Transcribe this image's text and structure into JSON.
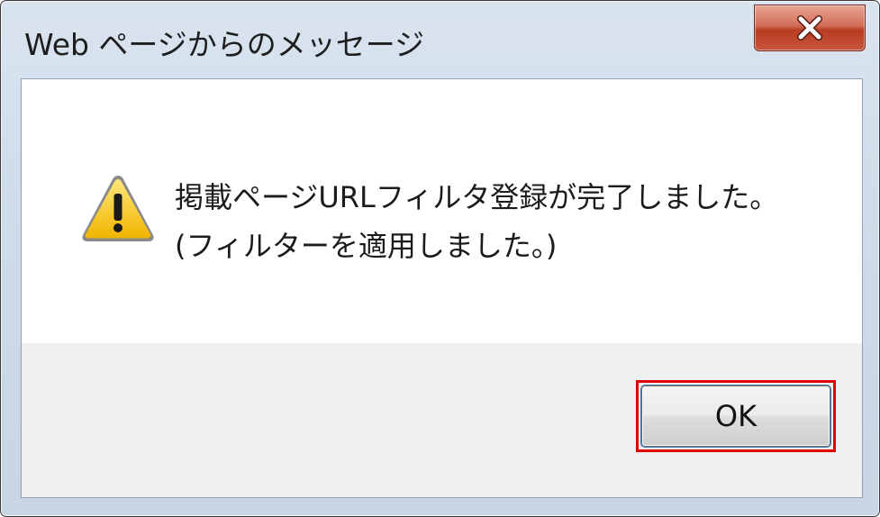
{
  "window": {
    "title": "Web ページからのメッセージ",
    "close_button_label": "x"
  },
  "message": {
    "icon": "warning-icon",
    "line1": "掲載ページURLフィルタ登録が完了しました。",
    "line2": "(フィルターを適用しました。)"
  },
  "buttons": {
    "ok_label": "OK"
  },
  "colors": {
    "highlight": "#e00000",
    "warning_yellow": "#f5c400"
  }
}
